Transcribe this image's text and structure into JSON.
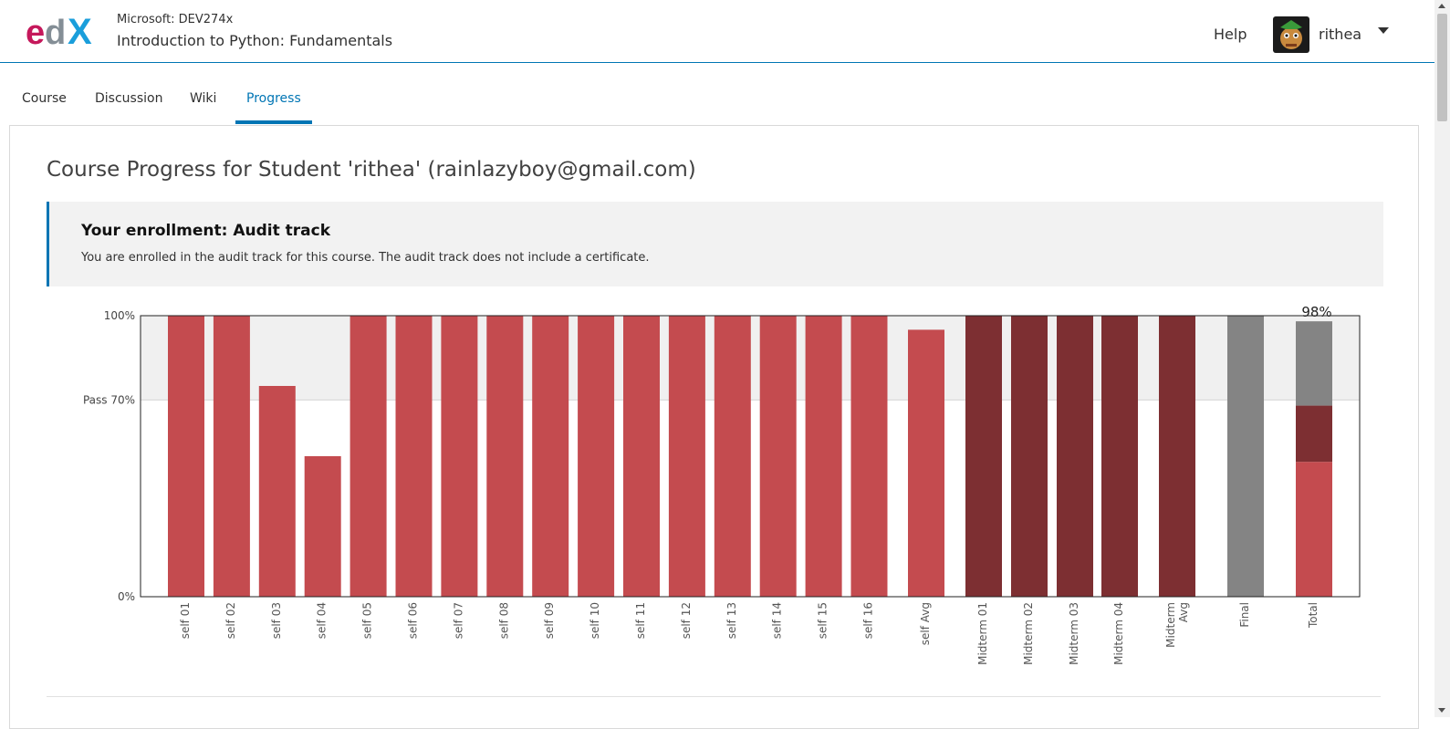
{
  "header": {
    "org": "Microsoft: DEV274x",
    "course_title": "Introduction to Python: Fundamentals",
    "help": "Help",
    "username": "rithea",
    "logo_icon": "edx-logo",
    "avatar_icon": "user-avatar",
    "dropdown_icon": "caret-down-icon"
  },
  "tabs": [
    {
      "label": "Course",
      "active": false
    },
    {
      "label": "Discussion",
      "active": false
    },
    {
      "label": "Wiki",
      "active": false
    },
    {
      "label": "Progress",
      "active": true
    }
  ],
  "page": {
    "title": "Course Progress for Student 'rithea' (rainlazyboy@gmail.com)",
    "enrollment_heading": "Your enrollment: Audit track",
    "enrollment_text": "You are enrolled in the audit track for this course. The audit track does not include a certificate."
  },
  "colors": {
    "accent": "#0075b4",
    "self_bar": "#c44b4f",
    "midterm_bar": "#7d2f32",
    "final_bar": "#848484",
    "pass_band": "#f0f0f0"
  },
  "chart_data": {
    "type": "bar",
    "ylim": [
      0,
      100
    ],
    "y_tick_labels": [
      "100%",
      "Pass 70%",
      "0%"
    ],
    "y_tick_values": [
      100,
      70,
      0
    ],
    "categories": [
      "self 01",
      "self 02",
      "self 03",
      "self 04",
      "self 05",
      "self 06",
      "self 07",
      "self 08",
      "self 09",
      "self 10",
      "self 11",
      "self 12",
      "self 13",
      "self 14",
      "self 15",
      "self 16",
      "self Avg",
      "Midterm 01",
      "Midterm 02",
      "Midterm 03",
      "Midterm 04",
      "Midterm Avg",
      "Final",
      "Total"
    ],
    "values": [
      100,
      100,
      75,
      50,
      100,
      100,
      100,
      100,
      100,
      100,
      100,
      100,
      100,
      100,
      100,
      100,
      95,
      100,
      100,
      100,
      100,
      100,
      100,
      98
    ],
    "groups": [
      "self",
      "self",
      "self",
      "self",
      "self",
      "self",
      "self",
      "self",
      "self",
      "self",
      "self",
      "self",
      "self",
      "self",
      "self",
      "self",
      "self",
      "midterm",
      "midterm",
      "midterm",
      "midterm",
      "midterm",
      "final",
      "total"
    ],
    "total_breakdown": [
      {
        "name": "self",
        "value": 48
      },
      {
        "name": "midterm",
        "value": 20
      },
      {
        "name": "final",
        "value": 30
      }
    ],
    "total_label": "98%"
  }
}
